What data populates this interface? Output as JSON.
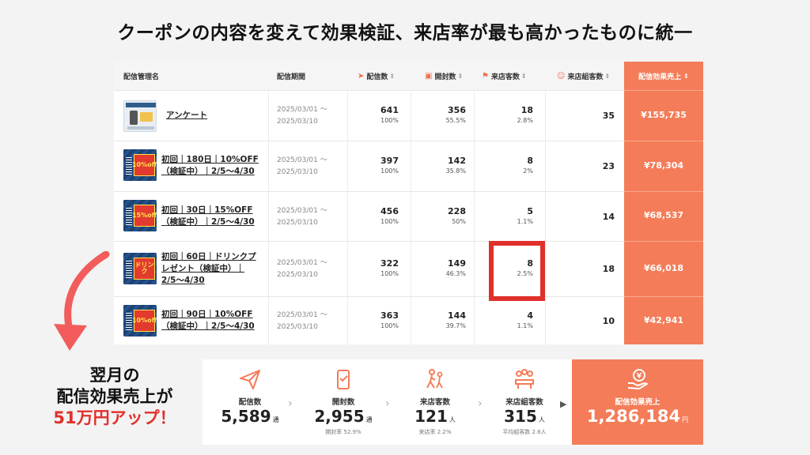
{
  "headline": "クーポンの内容を変えて効果検証、来店率が最も高かったものに統一",
  "colors": {
    "accent": "#f47c58",
    "highlight": "#e0302a"
  },
  "table": {
    "headers": {
      "name": "配信管理名",
      "period": "配信期間",
      "delivered": "配信数",
      "opened": "開封数",
      "visitors": "来店客数",
      "groups": "来店組客数",
      "sales": "配信効果売上"
    },
    "rows": [
      {
        "name_lines": [
          "アンケート"
        ],
        "thumb": "survey-thumbnail",
        "period": [
          "2025/03/01 〜",
          "2025/03/10"
        ],
        "delivered": "641",
        "delivered_pct": "100%",
        "opened": "356",
        "opened_pct": "55.5%",
        "visitors": "18",
        "visitors_pct": "2.8%",
        "groups": "35",
        "sales": "¥155,735"
      },
      {
        "name_lines": [
          "初回｜180日｜10%OFF",
          "（検証中）｜2/5〜4/30"
        ],
        "thumb": "coupon-thumbnail",
        "thumb_text": "10%off",
        "period": [
          "2025/03/01 〜",
          "2025/03/10"
        ],
        "delivered": "397",
        "delivered_pct": "100%",
        "opened": "142",
        "opened_pct": "35.8%",
        "visitors": "8",
        "visitors_pct": "2%",
        "groups": "23",
        "sales": "¥78,304"
      },
      {
        "name_lines": [
          "初回｜30日｜15%OFF",
          "（検証中）｜2/5〜4/30"
        ],
        "thumb": "coupon-thumbnail",
        "thumb_text": "15%off",
        "period": [
          "2025/03/01 〜",
          "2025/03/10"
        ],
        "delivered": "456",
        "delivered_pct": "100%",
        "opened": "228",
        "opened_pct": "50%",
        "visitors": "5",
        "visitors_pct": "1.1%",
        "groups": "14",
        "sales": "¥68,537"
      },
      {
        "name_lines": [
          "初回｜60日｜ドリンクプ",
          "レゼント（検証中）｜",
          "2/5〜4/30"
        ],
        "thumb": "coupon-thumbnail",
        "thumb_text": "ドリンク",
        "period": [
          "2025/03/01 〜",
          "2025/03/10"
        ],
        "delivered": "322",
        "delivered_pct": "100%",
        "opened": "149",
        "opened_pct": "46.3%",
        "visitors": "8",
        "visitors_pct": "2.5%",
        "groups": "18",
        "sales": "¥66,018"
      },
      {
        "name_lines": [
          "初回｜90日｜10%OFF",
          "（検証中）｜2/5〜4/30"
        ],
        "thumb": "coupon-thumbnail",
        "thumb_text": "10%off",
        "period": [
          "2025/03/01 〜",
          "2025/03/10"
        ],
        "delivered": "363",
        "delivered_pct": "100%",
        "opened": "144",
        "opened_pct": "39.7%",
        "visitors": "4",
        "visitors_pct": "1.1%",
        "groups": "10",
        "sales": "¥42,941"
      }
    ]
  },
  "callout": {
    "line1": "翌月の",
    "line2": "配信効果売上が",
    "line3": "51万円アップ！"
  },
  "summary": {
    "delivered": {
      "label": "配信数",
      "value": "5,589",
      "unit": "通"
    },
    "opened": {
      "label": "開封数",
      "value": "2,955",
      "unit": "通",
      "sub": "開封率 52.9%"
    },
    "visitors": {
      "label": "来店客数",
      "value": "121",
      "unit": "人",
      "sub": "来店率 2.2%"
    },
    "groups": {
      "label": "来店組客数",
      "value": "315",
      "unit": "人",
      "sub": "平均組客数 2.6人"
    },
    "sales": {
      "label": "配信効果売上",
      "value": "1,286,184",
      "unit": "円"
    }
  }
}
